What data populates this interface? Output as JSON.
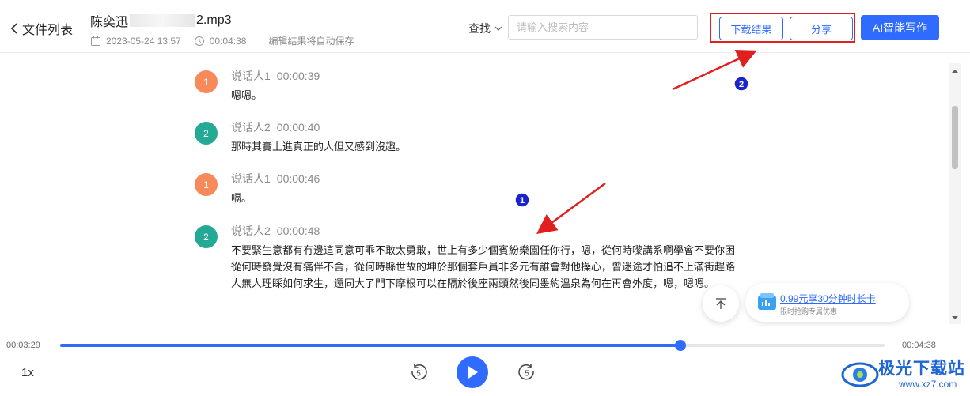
{
  "header": {
    "back_label": "文件列表",
    "file_name_prefix": "陈奕迅",
    "file_name_suffix": "2.mp3",
    "date": "2023-05-24 13:57",
    "duration": "00:04:38",
    "autosave_note": "编辑结果将自动保存",
    "search_label": "查找",
    "search_placeholder": "请输入搜索内容",
    "download_label": "下载结果",
    "share_label": "分享",
    "ai_label": "AI智能写作"
  },
  "transcript": [
    {
      "avatar": "1",
      "speaker": "说话人1",
      "time": "00:00:39",
      "text": "嗯嗯。"
    },
    {
      "avatar": "2",
      "speaker": "说话人2",
      "time": "00:00:40",
      "text": "那時其實上進真正的人但又感到沒趣。"
    },
    {
      "avatar": "1",
      "speaker": "说话人1",
      "time": "00:00:46",
      "text": "嗝。"
    },
    {
      "avatar": "2",
      "speaker": "说话人2",
      "time": "00:00:48",
      "text": "不要緊生意都有冇邊這同意可乖不敢太勇敢，世上有多少個賓紛樂園任你行，嗯，從何時嚟講系啊學會不要你困從何時發覺沒有痛伴不舍，從何時縣世故的坤於那個套戶員非多元有誰會對他操心，曾迷途才怕追不上滿街趕路人無人理睬如何求生，還同大了門下摩根可以在隔於後座兩頭然後同墨約溫泉為何在再會外度，嗯，嗯嗯。"
    }
  ],
  "promo": {
    "title": "0.99元享30分钟时长卡",
    "subtitle": "限时抢购专属优惠"
  },
  "player": {
    "current_time": "00:03:29",
    "total_time": "00:04:38",
    "progress": 0.752,
    "speed": "1x",
    "accent": "#2f6bff"
  },
  "annotations": {
    "badge_1": "1",
    "badge_2": "2",
    "arrow_color": "#e0201f"
  },
  "watermark": {
    "brand": "极光下载站",
    "url": "www.xz7.com"
  }
}
